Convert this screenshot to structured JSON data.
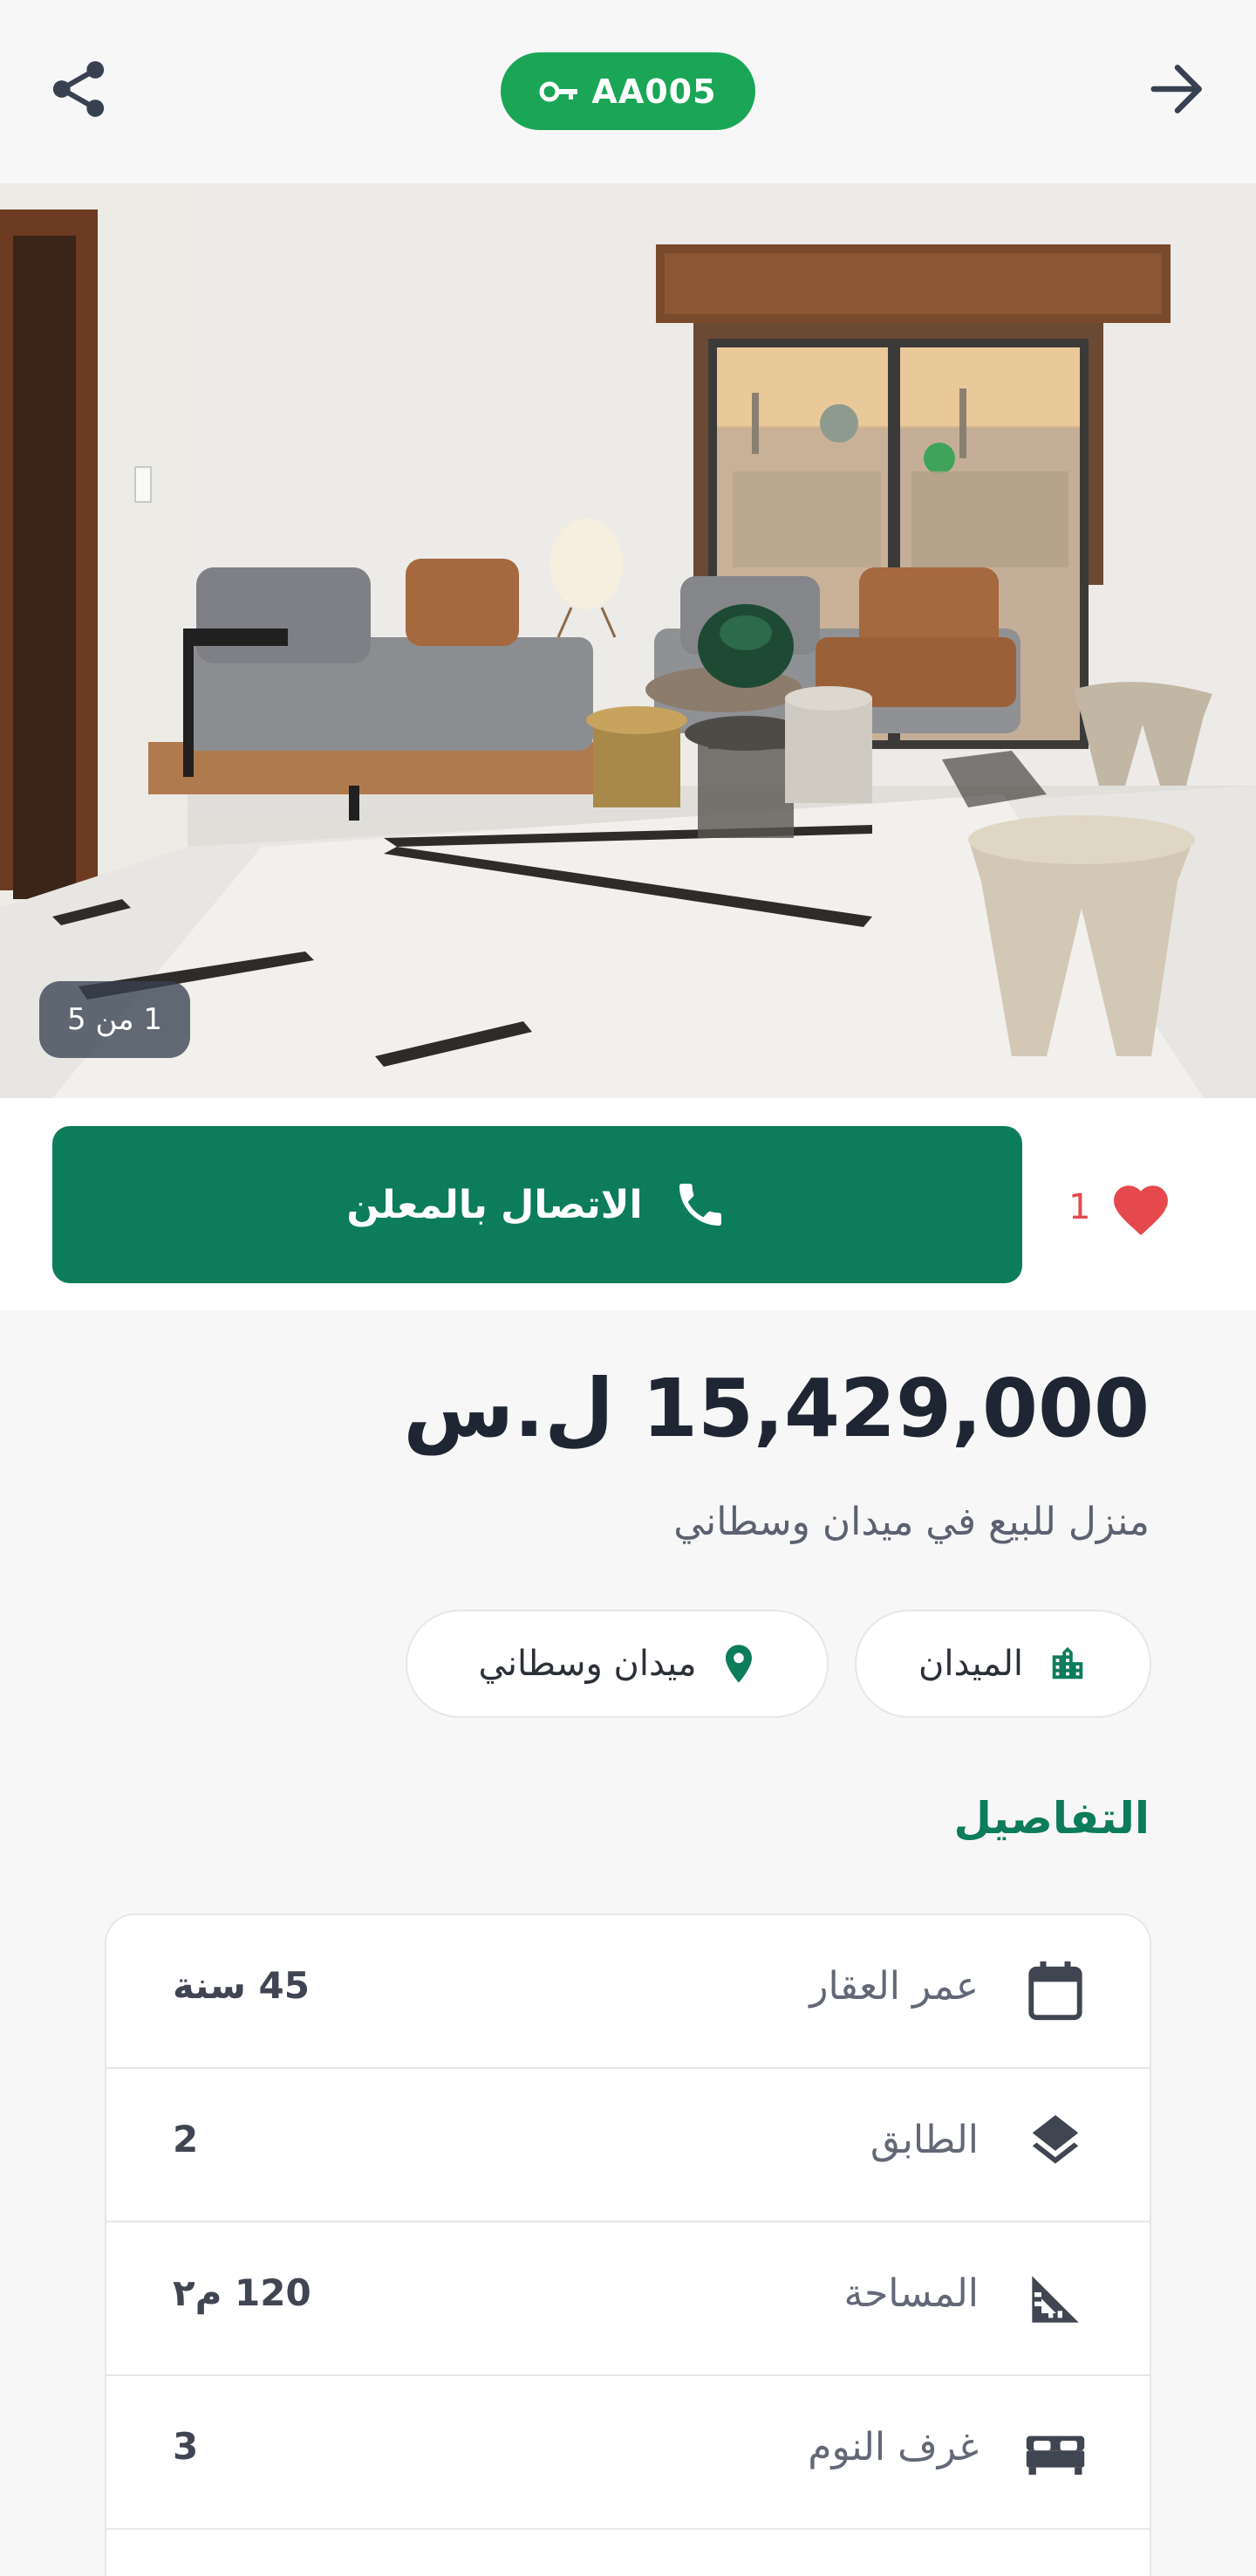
{
  "header": {
    "listing_code": "AA005",
    "icons": {
      "share": "share-icon",
      "back": "arrow-right-icon",
      "key": "key-icon"
    }
  },
  "gallery": {
    "counter_text": "1 من 5",
    "current": 1,
    "total": 5
  },
  "actions": {
    "call_label": "الاتصال بالمعلن",
    "favorites_count": "1",
    "colors": {
      "call_button": "#0c7c5a",
      "heart": "#e5484d"
    }
  },
  "listing": {
    "price": "15,429,000 ل.س",
    "title": "منزل للبيع في ميدان وسطاني",
    "district": "الميدان",
    "area": "ميدان وسطاني"
  },
  "details": {
    "section_title": "التفاصيل",
    "rows": [
      {
        "icon": "calendar-icon",
        "label": "عمر العقار",
        "value": "45 سنة"
      },
      {
        "icon": "layers-icon",
        "label": "الطابق",
        "value": "2"
      },
      {
        "icon": "set-square-icon",
        "label": "المساحة",
        "value": "120 م٢"
      },
      {
        "icon": "bed-icon",
        "label": "غرف النوم",
        "value": "3"
      }
    ]
  },
  "theme": {
    "brand_green": "#1aa656",
    "dark_green": "#0c7c5a"
  }
}
